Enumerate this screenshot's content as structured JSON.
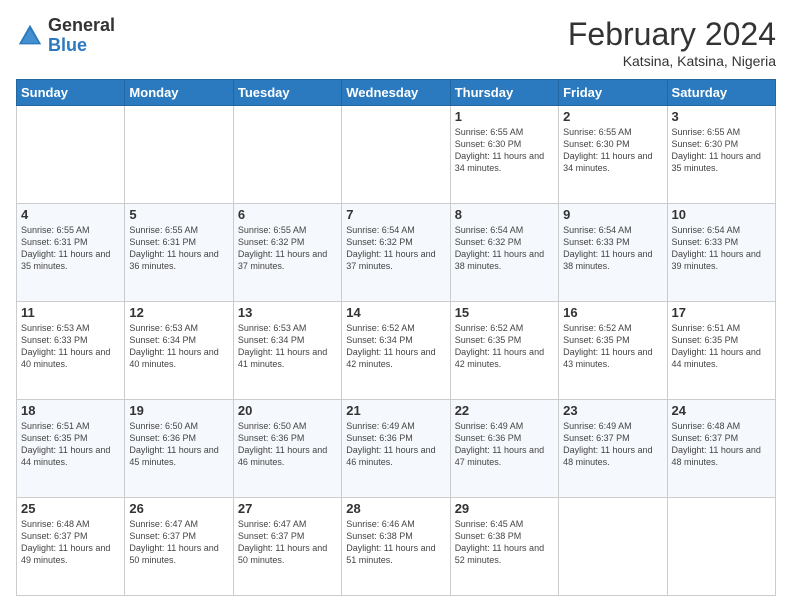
{
  "logo": {
    "general": "General",
    "blue": "Blue"
  },
  "header": {
    "title": "February 2024",
    "subtitle": "Katsina, Katsina, Nigeria"
  },
  "days_of_week": [
    "Sunday",
    "Monday",
    "Tuesday",
    "Wednesday",
    "Thursday",
    "Friday",
    "Saturday"
  ],
  "weeks": [
    [
      {
        "day": "",
        "info": ""
      },
      {
        "day": "",
        "info": ""
      },
      {
        "day": "",
        "info": ""
      },
      {
        "day": "",
        "info": ""
      },
      {
        "day": "1",
        "info": "Sunrise: 6:55 AM\nSunset: 6:30 PM\nDaylight: 11 hours and 34 minutes."
      },
      {
        "day": "2",
        "info": "Sunrise: 6:55 AM\nSunset: 6:30 PM\nDaylight: 11 hours and 34 minutes."
      },
      {
        "day": "3",
        "info": "Sunrise: 6:55 AM\nSunset: 6:30 PM\nDaylight: 11 hours and 35 minutes."
      }
    ],
    [
      {
        "day": "4",
        "info": "Sunrise: 6:55 AM\nSunset: 6:31 PM\nDaylight: 11 hours and 35 minutes."
      },
      {
        "day": "5",
        "info": "Sunrise: 6:55 AM\nSunset: 6:31 PM\nDaylight: 11 hours and 36 minutes."
      },
      {
        "day": "6",
        "info": "Sunrise: 6:55 AM\nSunset: 6:32 PM\nDaylight: 11 hours and 37 minutes."
      },
      {
        "day": "7",
        "info": "Sunrise: 6:54 AM\nSunset: 6:32 PM\nDaylight: 11 hours and 37 minutes."
      },
      {
        "day": "8",
        "info": "Sunrise: 6:54 AM\nSunset: 6:32 PM\nDaylight: 11 hours and 38 minutes."
      },
      {
        "day": "9",
        "info": "Sunrise: 6:54 AM\nSunset: 6:33 PM\nDaylight: 11 hours and 38 minutes."
      },
      {
        "day": "10",
        "info": "Sunrise: 6:54 AM\nSunset: 6:33 PM\nDaylight: 11 hours and 39 minutes."
      }
    ],
    [
      {
        "day": "11",
        "info": "Sunrise: 6:53 AM\nSunset: 6:33 PM\nDaylight: 11 hours and 40 minutes."
      },
      {
        "day": "12",
        "info": "Sunrise: 6:53 AM\nSunset: 6:34 PM\nDaylight: 11 hours and 40 minutes."
      },
      {
        "day": "13",
        "info": "Sunrise: 6:53 AM\nSunset: 6:34 PM\nDaylight: 11 hours and 41 minutes."
      },
      {
        "day": "14",
        "info": "Sunrise: 6:52 AM\nSunset: 6:34 PM\nDaylight: 11 hours and 42 minutes."
      },
      {
        "day": "15",
        "info": "Sunrise: 6:52 AM\nSunset: 6:35 PM\nDaylight: 11 hours and 42 minutes."
      },
      {
        "day": "16",
        "info": "Sunrise: 6:52 AM\nSunset: 6:35 PM\nDaylight: 11 hours and 43 minutes."
      },
      {
        "day": "17",
        "info": "Sunrise: 6:51 AM\nSunset: 6:35 PM\nDaylight: 11 hours and 44 minutes."
      }
    ],
    [
      {
        "day": "18",
        "info": "Sunrise: 6:51 AM\nSunset: 6:35 PM\nDaylight: 11 hours and 44 minutes."
      },
      {
        "day": "19",
        "info": "Sunrise: 6:50 AM\nSunset: 6:36 PM\nDaylight: 11 hours and 45 minutes."
      },
      {
        "day": "20",
        "info": "Sunrise: 6:50 AM\nSunset: 6:36 PM\nDaylight: 11 hours and 46 minutes."
      },
      {
        "day": "21",
        "info": "Sunrise: 6:49 AM\nSunset: 6:36 PM\nDaylight: 11 hours and 46 minutes."
      },
      {
        "day": "22",
        "info": "Sunrise: 6:49 AM\nSunset: 6:36 PM\nDaylight: 11 hours and 47 minutes."
      },
      {
        "day": "23",
        "info": "Sunrise: 6:49 AM\nSunset: 6:37 PM\nDaylight: 11 hours and 48 minutes."
      },
      {
        "day": "24",
        "info": "Sunrise: 6:48 AM\nSunset: 6:37 PM\nDaylight: 11 hours and 48 minutes."
      }
    ],
    [
      {
        "day": "25",
        "info": "Sunrise: 6:48 AM\nSunset: 6:37 PM\nDaylight: 11 hours and 49 minutes."
      },
      {
        "day": "26",
        "info": "Sunrise: 6:47 AM\nSunset: 6:37 PM\nDaylight: 11 hours and 50 minutes."
      },
      {
        "day": "27",
        "info": "Sunrise: 6:47 AM\nSunset: 6:37 PM\nDaylight: 11 hours and 50 minutes."
      },
      {
        "day": "28",
        "info": "Sunrise: 6:46 AM\nSunset: 6:38 PM\nDaylight: 11 hours and 51 minutes."
      },
      {
        "day": "29",
        "info": "Sunrise: 6:45 AM\nSunset: 6:38 PM\nDaylight: 11 hours and 52 minutes."
      },
      {
        "day": "",
        "info": ""
      },
      {
        "day": "",
        "info": ""
      }
    ]
  ]
}
